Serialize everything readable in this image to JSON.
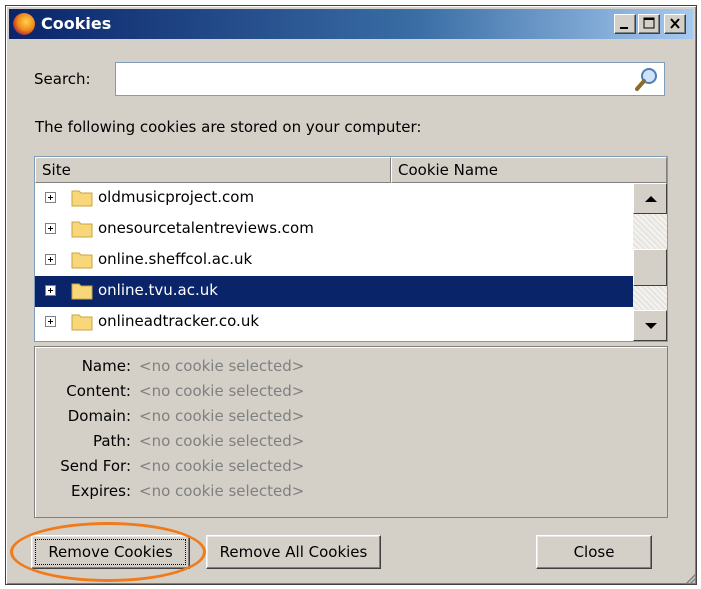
{
  "window": {
    "title": "Cookies",
    "icon": "firefox-icon"
  },
  "controls": {
    "minimize": "minimize-icon",
    "maximize": "maximize-icon",
    "close": "close-icon"
  },
  "search": {
    "label": "Search:",
    "value": "",
    "icon": "search-icon"
  },
  "info_text": "The following cookies are stored on your computer:",
  "tree": {
    "columns": [
      "Site",
      "Cookie Name"
    ],
    "rows": [
      {
        "site": "oldmusicproject.com",
        "selected": false
      },
      {
        "site": "onesourcetalentreviews.com",
        "selected": false
      },
      {
        "site": "online.sheffcol.ac.uk",
        "selected": false
      },
      {
        "site": "online.tvu.ac.uk",
        "selected": true
      },
      {
        "site": "onlineadtracker.co.uk",
        "selected": false
      }
    ]
  },
  "details": [
    {
      "key": "Name:",
      "value": "<no cookie selected>"
    },
    {
      "key": "Content:",
      "value": "<no cookie selected>"
    },
    {
      "key": "Domain:",
      "value": "<no cookie selected>"
    },
    {
      "key": "Path:",
      "value": "<no cookie selected>"
    },
    {
      "key": "Send For:",
      "value": "<no cookie selected>"
    },
    {
      "key": "Expires:",
      "value": "<no cookie selected>"
    }
  ],
  "buttons": {
    "remove": "Remove Cookies",
    "remove_all": "Remove All Cookies",
    "close": "Close"
  },
  "colors": {
    "selection": "#0a246a",
    "callout": "#f07b1c",
    "titlebar": "#0a246a"
  }
}
